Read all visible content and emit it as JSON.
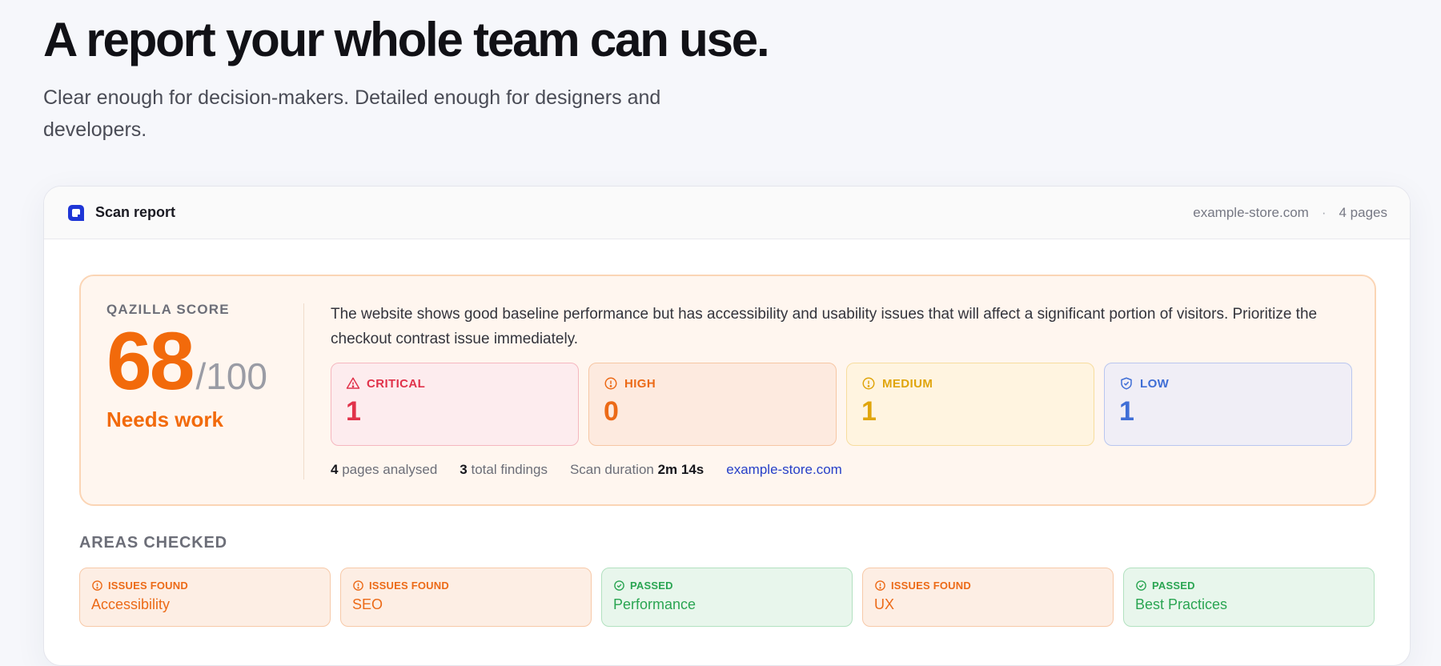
{
  "hero": {
    "title": "A report your whole team can use.",
    "subtitle": "Clear enough for decision-makers. Detailed enough for designers and developers."
  },
  "report": {
    "title": "Scan report",
    "site": "example-store.com",
    "separator": "·",
    "pages": "4 pages"
  },
  "score": {
    "label": "QAZILLA SCORE",
    "value": "68",
    "max": "/100",
    "status": "Needs work",
    "summary": "The website shows good baseline performance but has accessibility and usability issues that will affect a significant portion of visitors. Prioritize the checkout contrast issue immediately."
  },
  "severities": [
    {
      "label": "CRITICAL",
      "count": "1",
      "icon": "warning-triangle-icon",
      "color": "#e1324a"
    },
    {
      "label": "HIGH",
      "count": "0",
      "icon": "alert-circle-icon",
      "color": "#ec6a17"
    },
    {
      "label": "MEDIUM",
      "count": "1",
      "icon": "info-circle-icon",
      "color": "#e0a50c"
    },
    {
      "label": "LOW",
      "count": "1",
      "icon": "shield-check-icon",
      "color": "#3f6ed6"
    }
  ],
  "stats": {
    "pages_count": "4",
    "pages_label": "pages analysed",
    "findings_count": "3",
    "findings_label": "total findings",
    "duration_label": "Scan duration",
    "duration_value": "2m 14s",
    "site_link": "example-store.com"
  },
  "areas_label": "AREAS CHECKED",
  "areas": [
    {
      "status": "ISSUES FOUND",
      "name": "Accessibility",
      "icon": "alert-circle-icon"
    },
    {
      "status": "ISSUES FOUND",
      "name": "SEO",
      "icon": "alert-circle-icon"
    },
    {
      "status": "PASSED",
      "name": "Performance",
      "icon": "check-circle-icon"
    },
    {
      "status": "ISSUES FOUND",
      "name": "UX",
      "icon": "alert-circle-icon"
    },
    {
      "status": "PASSED",
      "name": "Best Practices",
      "icon": "check-circle-icon"
    }
  ],
  "colors": {
    "accent": "#f26a0b",
    "brand": "#1f36d6",
    "issue": "#ec6a17",
    "pass": "#2aa552",
    "link": "#2740c8"
  }
}
